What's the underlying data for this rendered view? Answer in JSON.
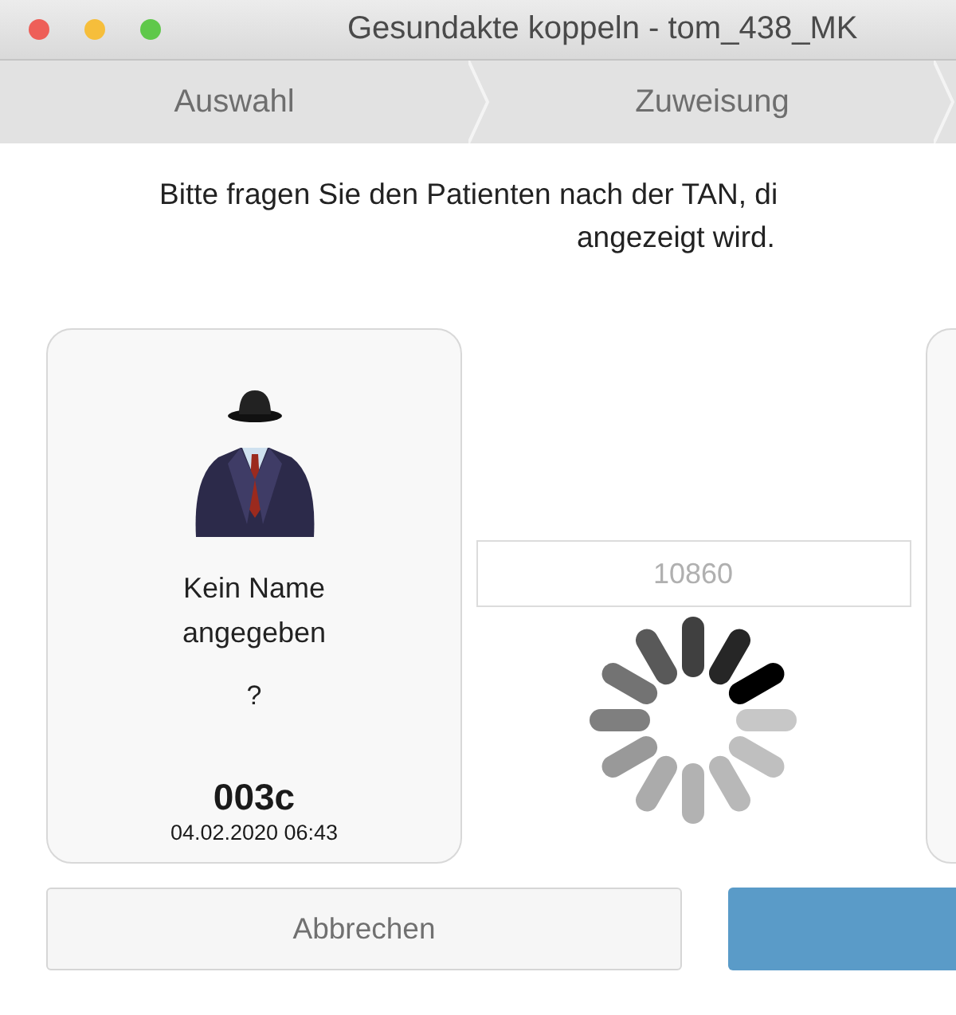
{
  "window": {
    "title": "Gesundakte koppeln - tom_438_MK"
  },
  "steps": [
    {
      "label": "Auswahl"
    },
    {
      "label": "Zuweisung"
    }
  ],
  "instruction": {
    "lines": [
      "Bitte fragen Sie den Patienten nach der TAN, di",
      "angezeigt wird."
    ]
  },
  "patient_card": {
    "name": "Kein Name angegeben",
    "detail": "?",
    "code": "003c",
    "date": "04.02.2020 06:43"
  },
  "tan_field": {
    "value": "10860",
    "disabled": true
  },
  "buttons": [
    {
      "kind": "secondary",
      "label": "Abbrechen"
    },
    {
      "kind": "primary"
    }
  ]
}
